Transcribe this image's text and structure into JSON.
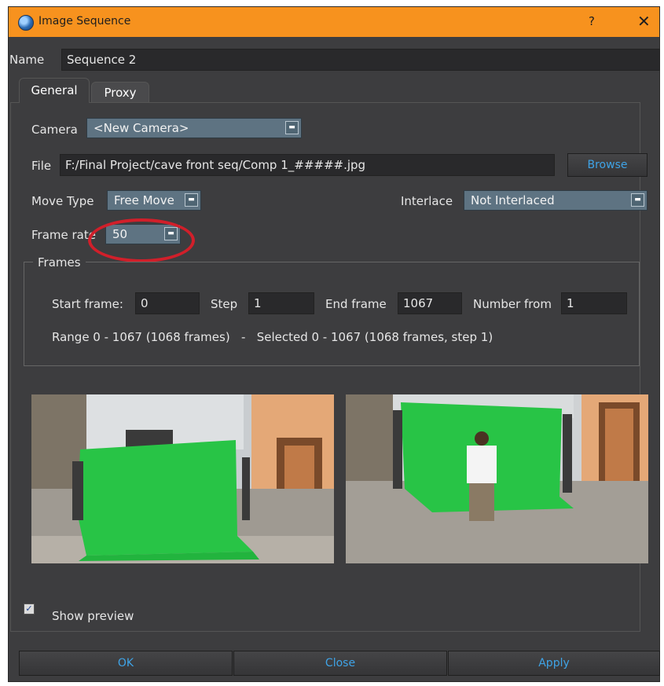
{
  "window": {
    "title": "Image Sequence",
    "help_label": "?",
    "close_label": "✕",
    "accent": "#f7921e"
  },
  "name_row": {
    "label": "Name",
    "value": "Sequence 2"
  },
  "tabs": [
    {
      "label": "General",
      "active": true
    },
    {
      "label": "Proxy",
      "active": false
    }
  ],
  "general": {
    "camera": {
      "label": "Camera",
      "value": "<New Camera>"
    },
    "file": {
      "label": "File",
      "value": "F:/Final Project/cave front seq/Comp 1_#####.jpg",
      "browse_label": "Browse"
    },
    "move_type": {
      "label": "Move Type",
      "value": "Free Move"
    },
    "interlace": {
      "label": "Interlace",
      "value": "Not Interlaced"
    },
    "frame_rate": {
      "label": "Frame rate",
      "value": "50"
    }
  },
  "frames": {
    "title": "Frames",
    "start_label": "Start frame:",
    "start_value": "0",
    "step_label": "Step",
    "step_value": "1",
    "end_label": "End frame",
    "end_value": "1067",
    "number_from_label": "Number from",
    "number_from_value": "1",
    "range_text": "Range 0 - 1067 (1068 frames)   -   Selected 0 - 1067 (1068 frames, step 1)"
  },
  "preview": {
    "show_label": "Show preview",
    "checked": true,
    "images": [
      "green-screen-first-frame",
      "green-screen-last-frame"
    ]
  },
  "buttons": {
    "ok": "OK",
    "close": "Close",
    "apply": "Apply",
    "text_color": "#3fa3e6"
  },
  "annotation": {
    "color": "#d11f2a"
  }
}
